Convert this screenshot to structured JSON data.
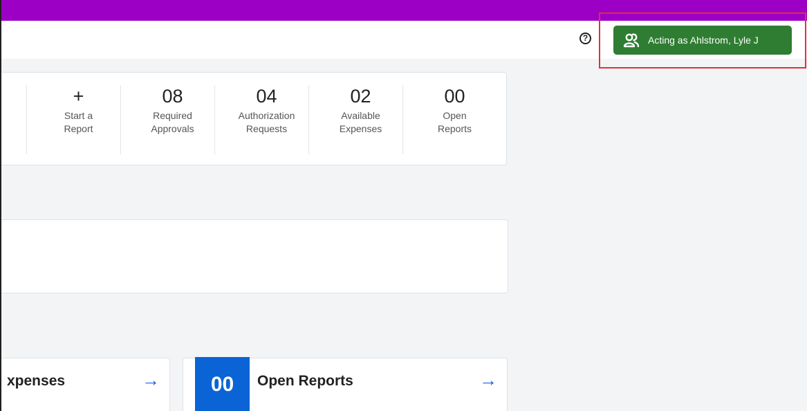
{
  "header": {
    "help_glyph": "?",
    "acting_as_label": "Acting as Ahlstrom, Lyle J"
  },
  "quick_stats": [
    {
      "value": "+",
      "line1": "Start a",
      "line2": "Report"
    },
    {
      "value": "08",
      "line1": "Required",
      "line2": "Approvals"
    },
    {
      "value": "04",
      "line1": "Authorization",
      "line2": "Requests"
    },
    {
      "value": "02",
      "line1": "Available",
      "line2": "Expenses"
    },
    {
      "value": "00",
      "line1": "Open",
      "line2": "Reports"
    }
  ],
  "tiles": [
    {
      "title": "xpenses",
      "arrow": "→"
    },
    {
      "count": "00",
      "title": "Open Reports",
      "arrow": "→"
    }
  ],
  "colors": {
    "top_bar": "#9b00c4",
    "acting_button": "#2f7d32",
    "highlight": "#e0303b",
    "badge": "#0a64d6",
    "arrow": "#1a5ce8",
    "page_background": "#f3f4f6"
  },
  "icons": {
    "help": "question-circle-icon",
    "acting": "users-icon",
    "arrow": "arrow-right-icon"
  }
}
